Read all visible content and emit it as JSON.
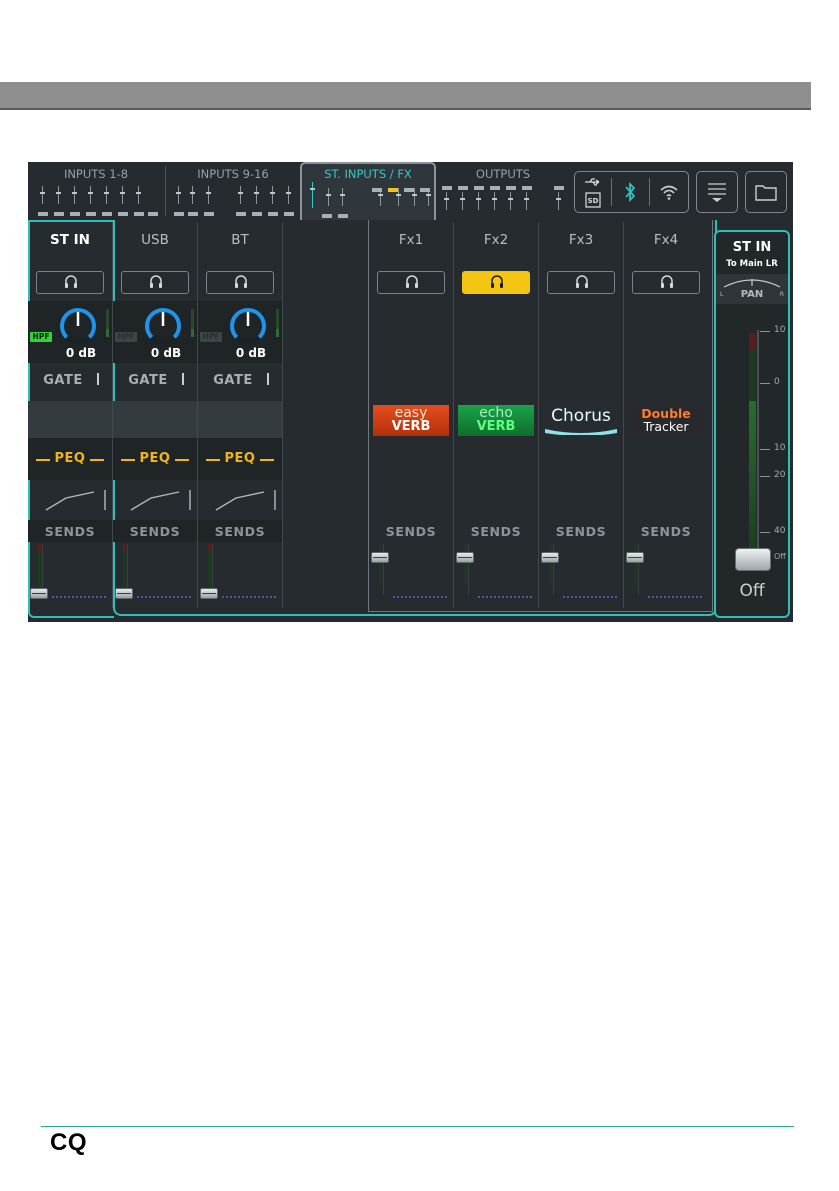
{
  "nav": {
    "tabs": [
      {
        "label": "INPUTS 1-8"
      },
      {
        "label": "INPUTS 9-16"
      },
      {
        "label": "ST. INPUTS / FX",
        "active": true
      },
      {
        "label": "OUTPUTS"
      }
    ],
    "status_icons": [
      "usb-icon",
      "sd-card-icon",
      "bluetooth-icon",
      "wifi-icon"
    ],
    "menu_icon": "menu-icon",
    "folder_icon": "folder-icon"
  },
  "channels": [
    {
      "name": "ST IN",
      "gain": "0 dB",
      "hpf": "HPF",
      "hpf_on": true,
      "gate": "GATE",
      "peq": "PEQ",
      "sends": "SENDS",
      "selected": true
    },
    {
      "name": "USB",
      "gain": "0 dB",
      "hpf": "HPF",
      "hpf_on": false,
      "gate": "GATE",
      "peq": "PEQ",
      "sends": "SENDS"
    },
    {
      "name": "BT",
      "gain": "0 dB",
      "hpf": "HPF",
      "hpf_on": false,
      "gate": "GATE",
      "peq": "PEQ",
      "sends": "SENDS"
    }
  ],
  "fx": [
    {
      "name": "Fx1",
      "effect_top": "easy",
      "effect_bottom": "VERB",
      "sends": "SENDS",
      "listen": false
    },
    {
      "name": "Fx2",
      "effect_top": "echo",
      "effect_bottom": "VERB",
      "sends": "SENDS",
      "listen": true
    },
    {
      "name": "Fx3",
      "effect_top": "Chorus",
      "effect_bottom": "",
      "sends": "SENDS",
      "listen": false
    },
    {
      "name": "Fx4",
      "effect_top": "Double",
      "effect_bottom": "Tracker",
      "sends": "SENDS",
      "listen": false
    }
  ],
  "master": {
    "name": "ST IN",
    "destination": "To Main LR",
    "pan": "PAN",
    "pan_left": "L",
    "pan_right": "R",
    "scale": [
      "10",
      "0",
      "10",
      "20",
      "40",
      "Off"
    ],
    "level": "Off"
  },
  "colors": {
    "accent": "#2fbfb7",
    "peq": "#f2b61c",
    "listen_active": "#f4c512",
    "knob": "#1e95e8",
    "hpf_on": "#36d23a"
  },
  "footer": {
    "logo": "CQ"
  }
}
